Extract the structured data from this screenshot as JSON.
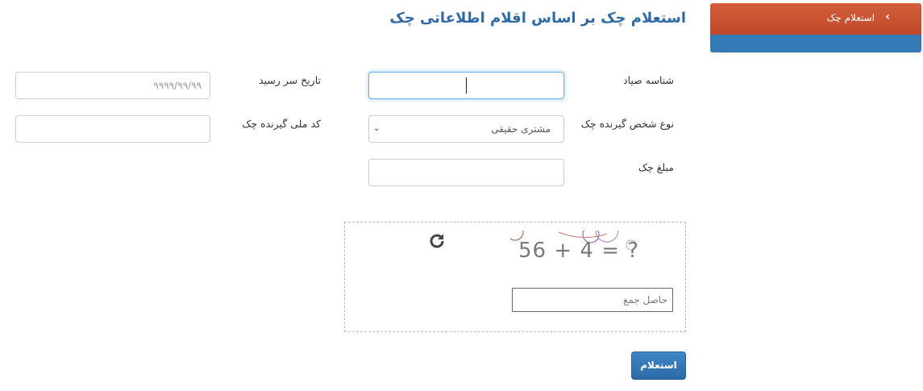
{
  "sidebar": {
    "active_item": "استعلام چک",
    "chevron": "‹"
  },
  "page": {
    "title": "استعلام چک بر اساس اقلام اطلاعاتی چک"
  },
  "form": {
    "sayad_id": {
      "label": "شناسه صیاد",
      "value": ""
    },
    "due_date": {
      "label": "تاریخ سر رسید",
      "placeholder": "۹۹۹۹/۹۹/۹۹"
    },
    "receiver_type": {
      "label": "نوع شخص گیرنده چک",
      "selected": "مشتری حقیقی",
      "arrow": "⌄"
    },
    "receiver_national_code": {
      "label": "کد ملی گیرنده چک",
      "value": ""
    },
    "amount": {
      "label": "مبلغ چک",
      "value": ""
    }
  },
  "captcha": {
    "expression": "56 + 4 = ?",
    "answer_placeholder": "حاصل جمع"
  },
  "actions": {
    "submit_label": "استعلام"
  },
  "colors": {
    "brand_orange": "#c9512f",
    "brand_blue": "#337ab7",
    "title_blue": "#2f6aa6"
  },
  "icons": {
    "refresh": "refresh-icon",
    "chevron": "chevron-left-icon"
  }
}
